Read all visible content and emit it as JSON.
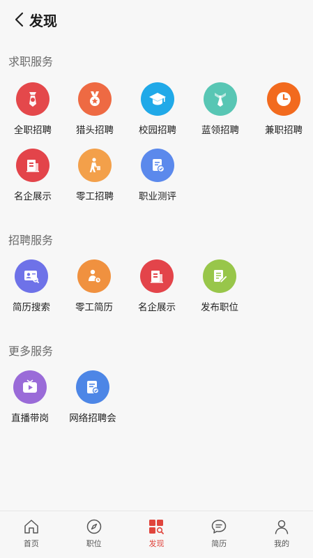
{
  "header": {
    "title": "发现"
  },
  "sections": [
    {
      "title": "求职服务",
      "items": [
        {
          "label": "全职招聘",
          "icon": "tie-icon",
          "color": "#e4484b"
        },
        {
          "label": "猎头招聘",
          "icon": "medal-icon",
          "color": "#ee6a43"
        },
        {
          "label": "校园招聘",
          "icon": "graduation-cap-icon",
          "color": "#20a9e8"
        },
        {
          "label": "蓝领招聘",
          "icon": "necktie-icon",
          "color": "#58c6b4"
        },
        {
          "label": "兼职招聘",
          "icon": "clock-icon",
          "color": "#f26a1e"
        },
        {
          "label": "名企展示",
          "icon": "company-icon",
          "color": "#e3444a"
        },
        {
          "label": "零工招聘",
          "icon": "worker-icon",
          "color": "#f3a04a"
        },
        {
          "label": "职业测评",
          "icon": "assessment-icon",
          "color": "#5b89ec"
        }
      ]
    },
    {
      "title": "招聘服务",
      "items": [
        {
          "label": "简历搜索",
          "icon": "resume-search-icon",
          "color": "#6e72e8"
        },
        {
          "label": "零工简历",
          "icon": "gig-resume-icon",
          "color": "#f0913f"
        },
        {
          "label": "名企展示",
          "icon": "company-icon",
          "color": "#e3444a"
        },
        {
          "label": "发布职位",
          "icon": "publish-job-icon",
          "color": "#98c64a"
        }
      ]
    },
    {
      "title": "更多服务",
      "items": [
        {
          "label": "直播带岗",
          "icon": "live-tv-icon",
          "color": "#9a6bd8"
        },
        {
          "label": "网络招聘会",
          "icon": "online-fair-icon",
          "color": "#4d86e6"
        }
      ]
    }
  ],
  "bottom_nav": {
    "items": [
      {
        "label": "首页",
        "icon": "home-icon",
        "active": false
      },
      {
        "label": "职位",
        "icon": "compass-icon",
        "active": false
      },
      {
        "label": "发现",
        "icon": "discover-icon",
        "active": true
      },
      {
        "label": "简历",
        "icon": "chat-icon",
        "active": false
      },
      {
        "label": "我的",
        "icon": "user-icon",
        "active": false
      }
    ],
    "active_color": "#e0453d"
  }
}
